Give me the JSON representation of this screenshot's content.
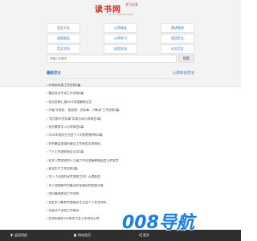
{
  "header": {
    "logo_title": "读书网",
    "logo_sub": "学习分享",
    "url": "m.47xueren.com"
  },
  "nav": {
    "items": [
      {
        "label": "范文大全"
      },
      {
        "label": "心得体会"
      },
      {
        "label": "演讲致辞"
      },
      {
        "label": "述职报告"
      },
      {
        "label": "心得学习"
      },
      {
        "label": "党团范文"
      },
      {
        "label": "范文写作"
      },
      {
        "label": "应用文档"
      },
      {
        "label": "论文范文"
      }
    ]
  },
  "search": {
    "placeholder": "请输入关键词",
    "button_label": "搜索"
  },
  "list": {
    "title": "最新范文",
    "more_label": "心得体会范文",
    "items": [
      "环保局年度工作总结5篇",
      "基层党员冬训工作总结5篇",
      "党员思想汇报2021年度最新范文",
      "开展“学党史、悟思想、办实事、开新局”工作总结3篇",
      "“我为群众办实事”实践活动心得体会3篇",
      "党员教育学习心得体会5篇",
      "2021年组织生活会个人对照检查材料3篇",
      "农村基层党组织建设工作经验交流材料",
      "个人工作述职报告范文3篇",
      "在学习贯彻党的十九届六中全会精神座谈会上的发言",
      "安全生产工作总结3篇",
      "学习《论党的宣传思想工作》心得体会",
      "关于加强新时代廉洁文化建设的实施方案",
      "党风廉政建设工作总结",
      "党史学习教育专题组织生活会个人发言材料",
      "全面从严治党工作报告",
      "在庆祝建党100周年大会上的讲话心得"
    ]
  },
  "footer": {
    "back_label": "返回顶部",
    "home_label": "网站首页",
    "share_label": "更多"
  },
  "watermark": {
    "label": "008导航"
  },
  "colors": {
    "accent": "#2a6fc9",
    "logo_red": "#c9281c",
    "footer_bg": "#2f2f2f"
  }
}
